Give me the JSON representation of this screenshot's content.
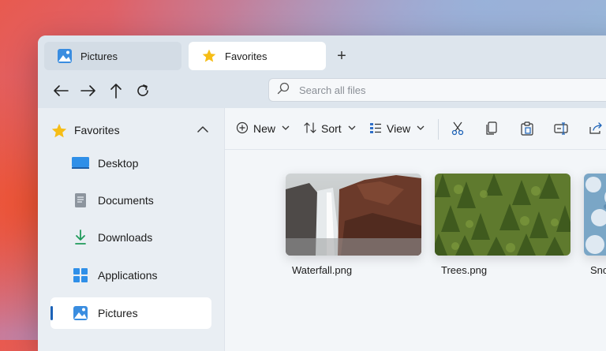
{
  "tabs": [
    {
      "label": "Pictures",
      "icon": "pictures-icon",
      "active": false
    },
    {
      "label": "Favorites",
      "icon": "star-icon",
      "active": true
    }
  ],
  "new_tab_label": "+",
  "search": {
    "placeholder": "Search all files",
    "value": ""
  },
  "sidebar": {
    "header": {
      "label": "Favorites",
      "icon": "star-icon",
      "expanded": true
    },
    "items": [
      {
        "label": "Desktop",
        "icon": "desktop-icon",
        "selected": false
      },
      {
        "label": "Documents",
        "icon": "documents-icon",
        "selected": false
      },
      {
        "label": "Downloads",
        "icon": "downloads-icon",
        "selected": false
      },
      {
        "label": "Applications",
        "icon": "applications-icon",
        "selected": false
      },
      {
        "label": "Pictures",
        "icon": "pictures-icon",
        "selected": true
      }
    ]
  },
  "commandbar": {
    "new_label": "New",
    "sort_label": "Sort",
    "view_label": "View",
    "icons": [
      "cut-icon",
      "copy-icon",
      "paste-icon",
      "rename-icon",
      "share-icon"
    ]
  },
  "files": [
    {
      "name": "Waterfall.png"
    },
    {
      "name": "Trees.png"
    },
    {
      "name": "Snow.png"
    }
  ],
  "colors": {
    "accent": "#1d63b8",
    "star": "#f6bd16",
    "window_bg": "#f1f4f8",
    "titlebar_bg": "#dde5ed"
  }
}
